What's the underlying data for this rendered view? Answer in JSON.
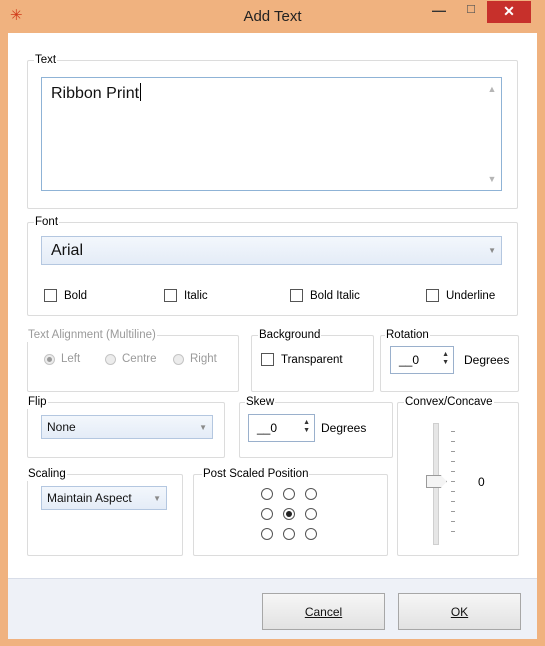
{
  "window": {
    "title": "Add Text",
    "minimize_glyph": "—",
    "maximize_glyph": "☐",
    "close_glyph": "✕",
    "app_icon": "app-logo-icon",
    "frame_color": "#f0b27f",
    "close_color": "#c7302b"
  },
  "text_group": {
    "label": "Text",
    "value": "Ribbon Print"
  },
  "font_group": {
    "label": "Font",
    "font_value": "Arial",
    "bold_label": "Bold",
    "italic_label": "Italic",
    "bold_italic_label": "Bold Italic",
    "underline_label": "Underline"
  },
  "alignment": {
    "label": "Text Alignment (Multiline)",
    "left_label": "Left",
    "centre_label": "Centre",
    "right_label": "Right",
    "selected": "Left"
  },
  "background": {
    "label": "Background",
    "transparent_label": "Transparent"
  },
  "rotation": {
    "label": "Rotation",
    "value": "__0",
    "unit": "Degrees"
  },
  "flip": {
    "label": "Flip",
    "value": "None"
  },
  "skew": {
    "label": "Skew",
    "value": "__0",
    "unit": "Degrees"
  },
  "convex": {
    "label": "Convex/Concave",
    "value": "0"
  },
  "scaling": {
    "label": "Scaling",
    "value": "Maintain Aspect"
  },
  "post_scaled": {
    "label": "Post Scaled Position",
    "selected": "center"
  },
  "buttons": {
    "cancel_label": "Cancel",
    "ok_label": "OK"
  }
}
